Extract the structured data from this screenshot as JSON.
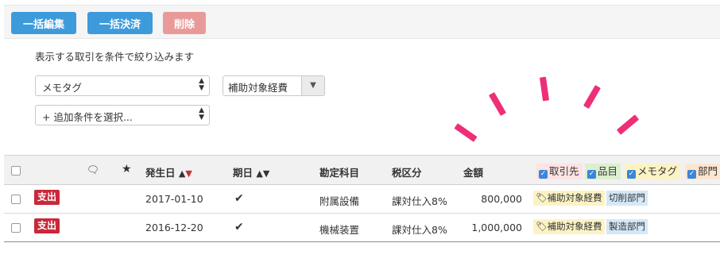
{
  "toolbar": {
    "bulk_edit": "一括編集",
    "bulk_settle": "一括決済",
    "delete": "削除"
  },
  "filter": {
    "title": "表示する取引を条件で絞り込みます",
    "field_select": "メモタグ",
    "tag_value": "補助対象経費",
    "add_condition": "+ 追加条件を選択..."
  },
  "table": {
    "headers": {
      "issue_date": "発生日",
      "due_date": "期日",
      "account": "勘定科目",
      "tax": "税区分",
      "amount": "金額"
    },
    "column_toggles": [
      {
        "label": "取引先",
        "color": "#fde3e3"
      },
      {
        "label": "品目",
        "color": "#dcefcf"
      },
      {
        "label": "メモタグ",
        "color": "#fcf3c5"
      },
      {
        "label": "部門",
        "color": "#fde6cf"
      }
    ],
    "rows": [
      {
        "type": "支出",
        "issue_date": "2017-01-10",
        "due_check": "✔",
        "account": "附属設備",
        "tax": "課対仕入8%",
        "amount": "800,000",
        "memo_tag": "補助対象経費",
        "dept": "切削部門"
      },
      {
        "type": "支出",
        "issue_date": "2016-12-20",
        "due_check": "✔",
        "account": "機械装置",
        "tax": "課対仕入8%",
        "amount": "1,000,000",
        "memo_tag": "補助対象経費",
        "dept": "製造部門"
      }
    ]
  },
  "colors": {
    "primary": "#3d9bdc",
    "danger": "#e89a98",
    "expense": "#c9283a",
    "highlight": "#ee2f78",
    "memo_tag_bg": "#fcf3c5",
    "dept_bg": "#d4e8f8"
  }
}
